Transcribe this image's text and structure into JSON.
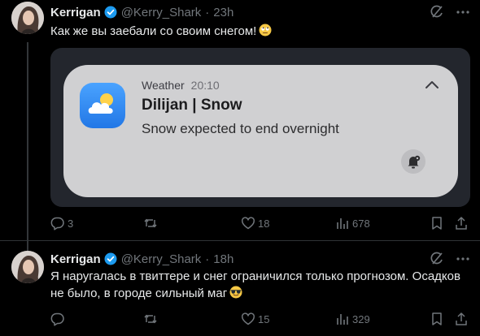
{
  "tweets": [
    {
      "author": "Kerrigan",
      "handle": "@Kerry_Shark",
      "time": "23h",
      "text": "Как же вы заебали со своим снегом!",
      "emoji": "rolling-eyes-face",
      "notification": {
        "app": "Weather",
        "time": "20:10",
        "title": "Dilijan | Snow",
        "body": "Snow expected to end overnight"
      },
      "replies": "3",
      "reposts": "",
      "likes": "18",
      "views": "678"
    },
    {
      "author": "Kerrigan",
      "handle": "@Kerry_Shark",
      "time": "18h",
      "text": "Я наругалась в твиттере и снег ограничился только прогнозом. Осадков не было, в городе сильный маг",
      "emoji": "sunglasses-face",
      "replies": "",
      "reposts": "",
      "likes": "15",
      "views": "329"
    }
  ],
  "colors": {
    "background": "#000000",
    "text": "#e7e9ea",
    "muted": "#71767b",
    "verified": "#1d9bf0",
    "divider": "#2f3336"
  }
}
